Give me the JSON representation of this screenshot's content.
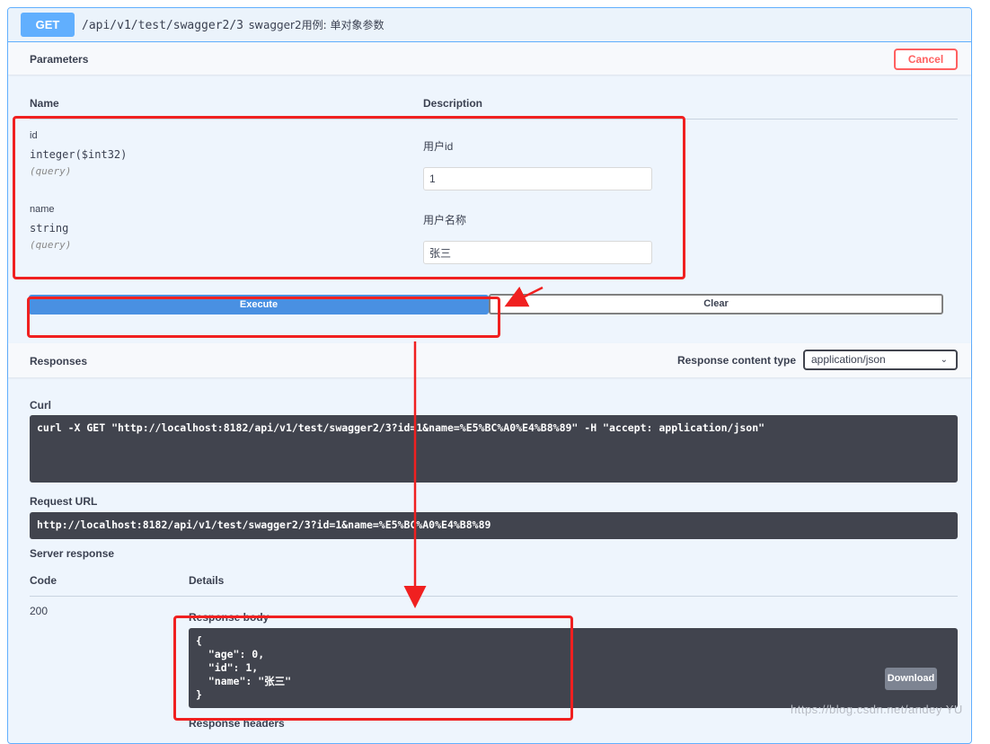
{
  "endpoint": {
    "method": "GET",
    "path": "/api/v1/test/swagger2/3",
    "description": "swagger2用例: 单对象参数"
  },
  "parameters": {
    "title": "Parameters",
    "cancel_label": "Cancel",
    "col_name": "Name",
    "col_description": "Description",
    "items": [
      {
        "name": "id",
        "type": "integer($int32)",
        "in": "(query)",
        "description": "用户id",
        "value": "1"
      },
      {
        "name": "name",
        "type": "string",
        "in": "(query)",
        "description": "用户名称",
        "value": "张三"
      }
    ],
    "execute_label": "Execute",
    "clear_label": "Clear"
  },
  "responses": {
    "title": "Responses",
    "content_type_label": "Response content type",
    "content_type_value": "application/json",
    "curl_label": "Curl",
    "curl": "curl -X GET \"http://localhost:8182/api/v1/test/swagger2/3?id=1&name=%E5%BC%A0%E4%B8%89\" -H \"accept: application/json\"",
    "request_url_label": "Request URL",
    "request_url": "http://localhost:8182/api/v1/test/swagger2/3?id=1&name=%E5%BC%A0%E4%B8%89",
    "server_response_label": "Server response",
    "code_col": "Code",
    "details_col": "Details",
    "code": "200",
    "response_body_label": "Response body",
    "response_body": "{\n  \"age\": 0,\n  \"id\": 1,\n  \"name\": \"张三\"\n}",
    "download_label": "Download",
    "response_headers_label": "Response headers"
  },
  "watermark": "https://blog.csdn.net/andey YU",
  "colors": {
    "get_blue": "#61affe",
    "execute_blue": "#4990e2",
    "cancel_red": "#ff6060",
    "annotation_red": "#f02020",
    "code_bg": "#41444e"
  }
}
